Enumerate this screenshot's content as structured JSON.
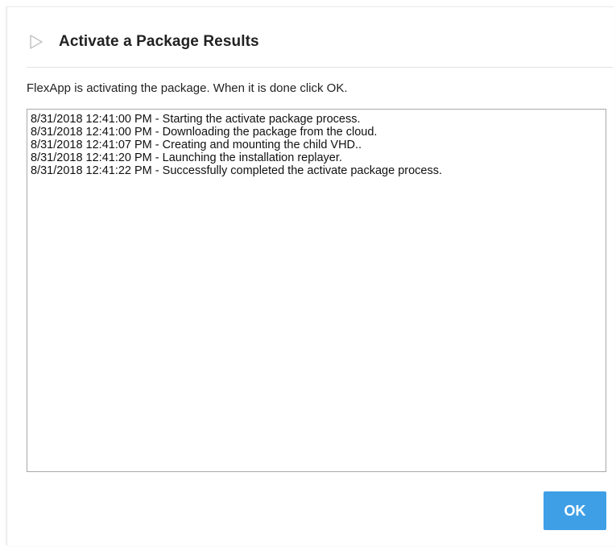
{
  "dialog": {
    "title": "Activate a Package Results",
    "title_icon": "play-triangle-icon",
    "description": "FlexApp is activating the package. When it is done click OK.",
    "log_lines": [
      "8/31/2018 12:41:00 PM - Starting the activate package process.",
      "8/31/2018 12:41:00 PM - Downloading the package from the cloud.",
      "8/31/2018 12:41:07 PM - Creating and mounting the child VHD..",
      "8/31/2018 12:41:20 PM - Launching the installation replayer.",
      "8/31/2018 12:41:22 PM - Successfully completed the activate package process."
    ],
    "ok_label": "OK"
  },
  "colors": {
    "ok_button": "#3f9fe6",
    "title_text": "#222222",
    "icon": "#c8c8c8"
  }
}
